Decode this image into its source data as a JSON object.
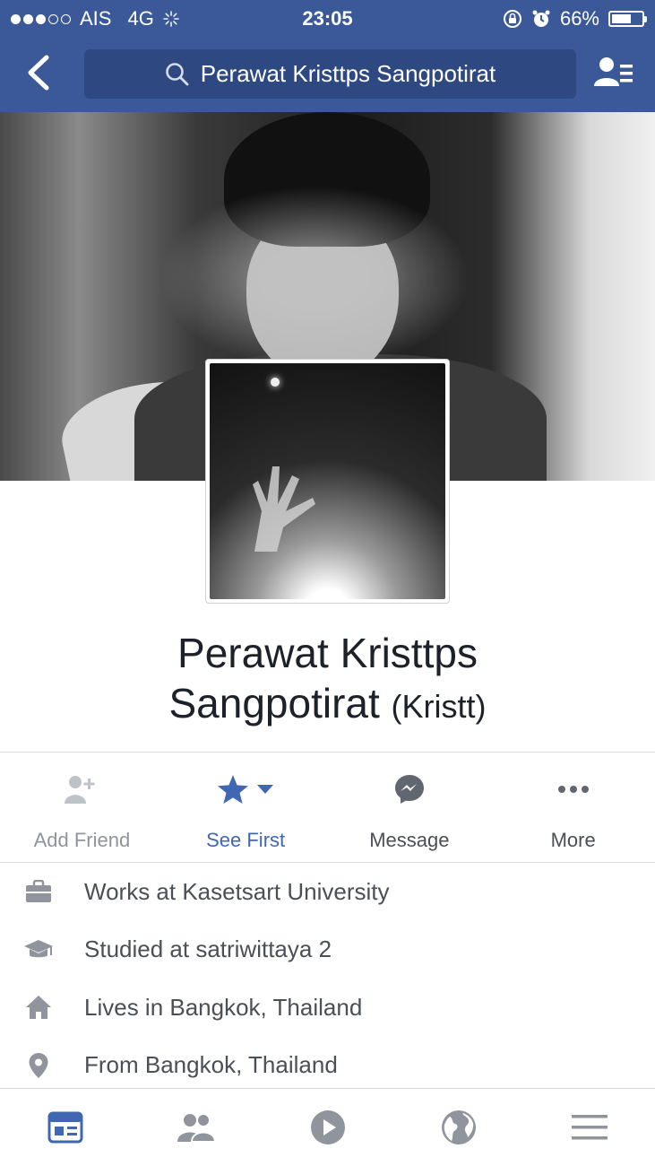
{
  "status_bar": {
    "carrier": "AIS",
    "network": "4G",
    "time": "23:05",
    "battery": "66%",
    "battery_level": 0.66
  },
  "nav": {
    "search_text": "Perawat Kristtps Sangpotirat"
  },
  "profile": {
    "name_line1": "Perawat Kristtps",
    "name_line2": "Sangpotirat",
    "nickname": "(Kristt)"
  },
  "actions": [
    {
      "label": "Add Friend",
      "icon": "add-friend-icon"
    },
    {
      "label": "See First",
      "icon": "star-icon"
    },
    {
      "label": "Message",
      "icon": "messenger-icon"
    },
    {
      "label": "More",
      "icon": "more-icon"
    }
  ],
  "info": [
    {
      "text": "Works at Kasetsart University",
      "icon": "briefcase-icon"
    },
    {
      "text": "Studied at satriwittaya 2",
      "icon": "graduation-cap-icon"
    },
    {
      "text": "Lives in Bangkok, Thailand",
      "icon": "home-icon"
    },
    {
      "text": "From Bangkok, Thailand",
      "icon": "location-pin-icon"
    }
  ],
  "tabs": [
    {
      "icon": "news-feed-icon",
      "active": true
    },
    {
      "icon": "friends-icon"
    },
    {
      "icon": "video-icon"
    },
    {
      "icon": "globe-icon"
    },
    {
      "icon": "menu-icon"
    }
  ],
  "colors": {
    "brand_blue": "#3b5998",
    "search_bg": "#2e4882",
    "link_blue": "#4267b2",
    "icon_gray": "#90949c"
  }
}
